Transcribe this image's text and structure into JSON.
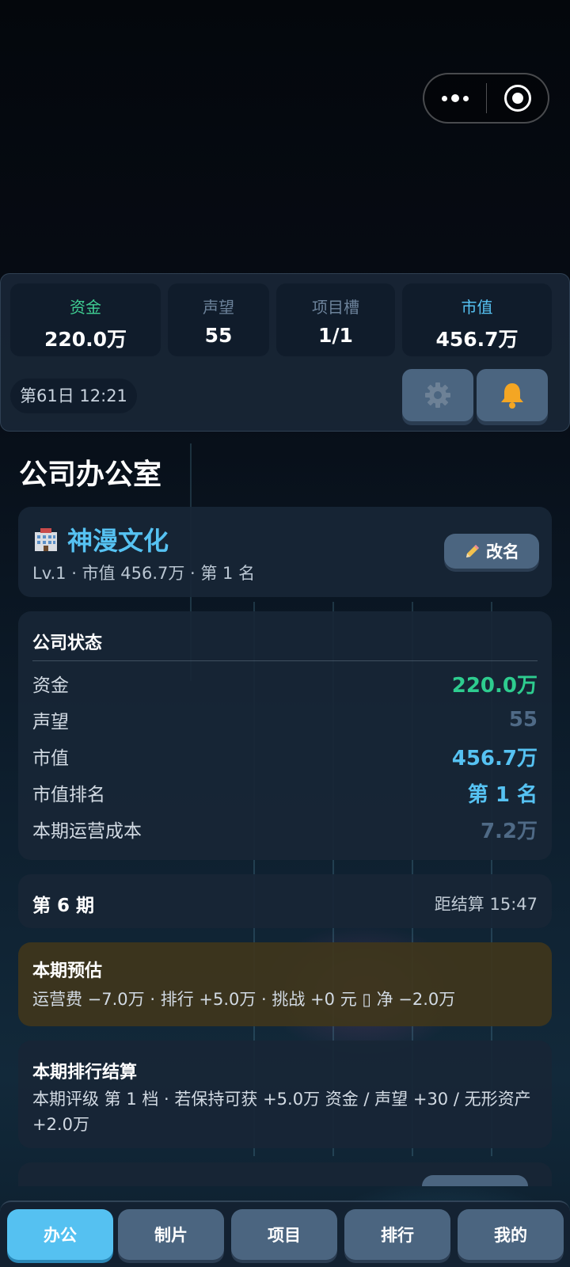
{
  "stats": {
    "funds": {
      "label": "资金",
      "value": "220.0万"
    },
    "reputation": {
      "label": "声望",
      "value": "55"
    },
    "slots": {
      "label": "项目槽",
      "value": "1/1"
    },
    "market": {
      "label": "市值",
      "value": "456.7万"
    },
    "day": "第61日 12:21"
  },
  "page": {
    "title": "公司办公室"
  },
  "company": {
    "name": "神漫文化",
    "sub": "Lv.1 · 市值 456.7万 · 第 1 名",
    "rename": "改名"
  },
  "status": {
    "title": "公司状态",
    "rows": [
      {
        "k": "资金",
        "v": "220.0万",
        "color": "#2ecc8f"
      },
      {
        "k": "声望",
        "v": "55",
        "color": "#4f6a86"
      },
      {
        "k": "市值",
        "v": "456.7万",
        "color": "#56c2f2"
      },
      {
        "k": "市值排名",
        "v": "第 1 名",
        "color": "#56c2f2"
      },
      {
        "k": "本期运营成本",
        "v": "7.2万",
        "color": "#4f6a86"
      }
    ]
  },
  "period": {
    "label": "第 6 期",
    "countdown": "距结算 15:47"
  },
  "estimate": {
    "title": "本期预估",
    "text": "运营费 −7.0万 · 排行 +5.0万 · 挑战 +0 元 ▯  净 −2.0万"
  },
  "ranking": {
    "title": "本期排行结算",
    "text": "本期评级 第 1 档 · 若保持可获 +5.0万 资金 / 声望 +30 / 无形资产 +2.0万"
  },
  "nav": {
    "tabs": [
      "办公",
      "制片",
      "项目",
      "排行",
      "我的"
    ]
  }
}
